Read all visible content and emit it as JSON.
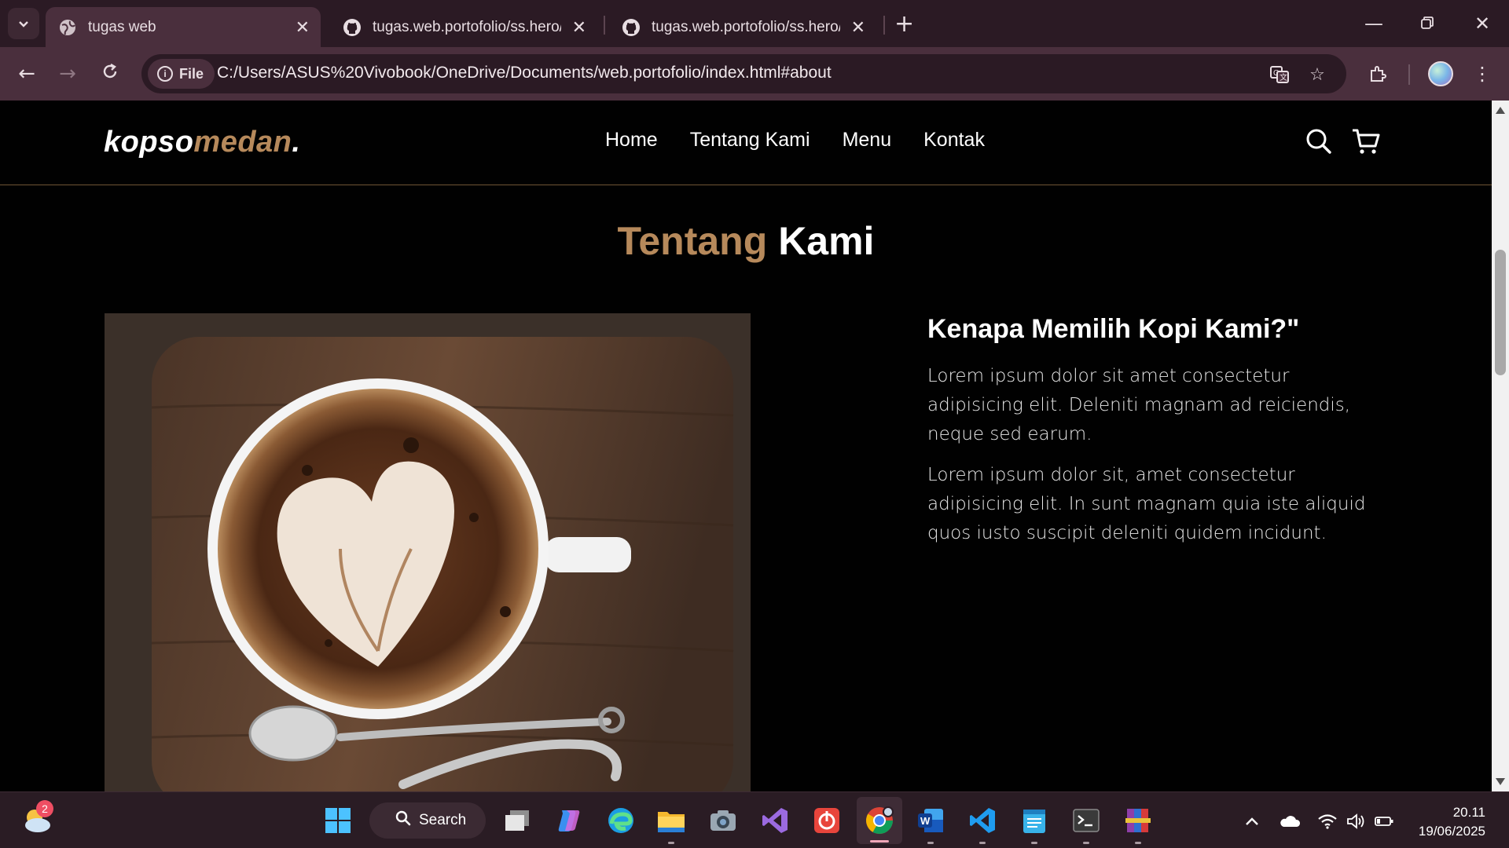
{
  "browser": {
    "tabs": [
      {
        "title": "tugas web",
        "active": true
      },
      {
        "title": "tugas.web.portofolio/ss.hero/Sc",
        "active": false
      },
      {
        "title": "tugas.web.portofolio/ss.hero/Sc",
        "active": false
      }
    ],
    "site_chip": "File",
    "url": "C:/Users/ASUS%20Vivobook/OneDrive/Documents/web.portofolio/index.html#about"
  },
  "site": {
    "logo_main": "kopso",
    "logo_accent": "medan",
    "logo_dot": ".",
    "nav": [
      "Home",
      "Tentang Kami",
      "Menu",
      "Kontak"
    ],
    "section_title_accent": "Tentang",
    "section_title_main": "Kami",
    "about": {
      "heading": "Kenapa Memilih Kopi Kami?\"",
      "paragraphs": [
        "Lorem ipsum dolor sit amet consectetur adipisicing elit. Deleniti magnam ad reiciendis, neque sed earum.",
        "Lorem ipsum dolor sit, amet consectetur adipisicing elit. In sunt magnam quia iste aliquid quos iusto suscipit deleniti quidem incidunt."
      ]
    },
    "accent_color": "#b6895b"
  },
  "taskbar": {
    "search_label": "Search",
    "weather_badge": "2",
    "time": "20.11",
    "date": "19/06/2025"
  }
}
